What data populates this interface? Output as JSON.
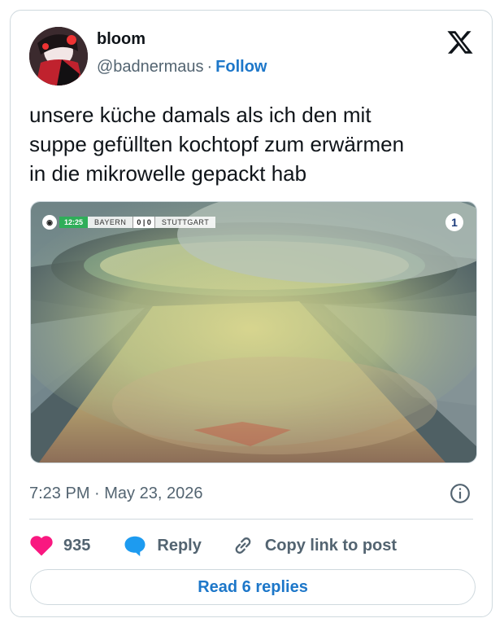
{
  "tweet": {
    "display_name": "bloom",
    "handle": "@badnermaus",
    "separator": "·",
    "follow_label": "Follow",
    "text": "unsere küche damals als ich den mit\nsuppe gefüllten kochtopf zum erwärmen\nin die mikrowelle gepackt hab",
    "timestamp": "7:23 PM · May 23, 2026",
    "likes": "935",
    "reply_label": "Reply",
    "copy_label": "Copy link to post",
    "read_replies_label": "Read 6 replies"
  },
  "media": {
    "scorebug": {
      "time": "12:25",
      "team_home": "BAYERN",
      "score": "0 | 0",
      "team_away": "STUTTGART"
    },
    "channel_logo": "1"
  },
  "icons": {
    "platform": "x-logo-icon",
    "like": "heart-icon",
    "reply": "speech-bubble-icon",
    "copy": "link-icon",
    "info": "info-icon"
  },
  "colors": {
    "accent": "#1d77c9",
    "like": "#f91880",
    "reply": "#1d9bf0",
    "text": "#0f1419",
    "muted": "#536471",
    "border": "#cfd9de"
  }
}
